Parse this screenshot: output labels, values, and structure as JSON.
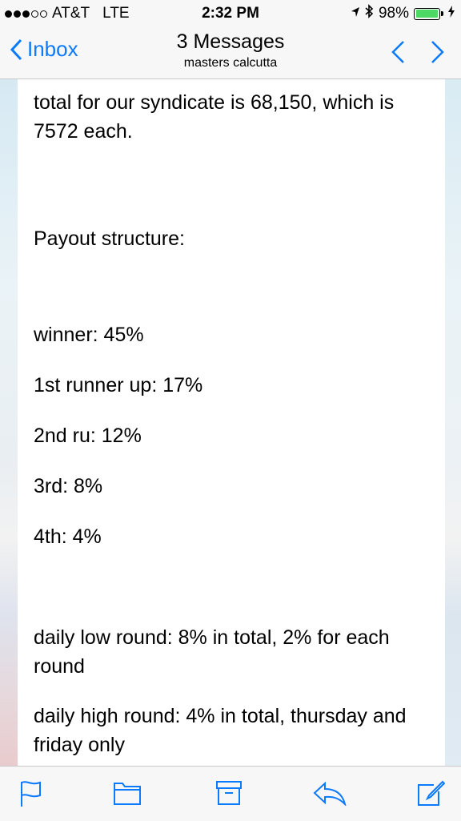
{
  "status_bar": {
    "carrier": "AT&T",
    "network": "LTE",
    "time": "2:32 PM",
    "battery_percent": "98%",
    "battery_level": 0.98
  },
  "nav": {
    "back_label": "Inbox",
    "title": "3 Messages",
    "subtitle": "masters calcutta"
  },
  "message": {
    "lines": [
      "total for our syndicate is 68,150, which is 7572 each.",
      "Payout structure:",
      "winner: 45%",
      "1st runner up: 17%",
      "2nd ru: 12%",
      "3rd: 8%",
      "4th: 4%",
      "daily low round: 8% in total, 2% for each round",
      "daily high round:  4% in total, thursday and friday only"
    ]
  },
  "colors": {
    "accent": "#0a7aff",
    "battery": "#4cd964"
  },
  "toolbar": {
    "icons": [
      "flag-icon",
      "folder-icon",
      "archive-icon",
      "reply-icon",
      "compose-icon"
    ]
  }
}
